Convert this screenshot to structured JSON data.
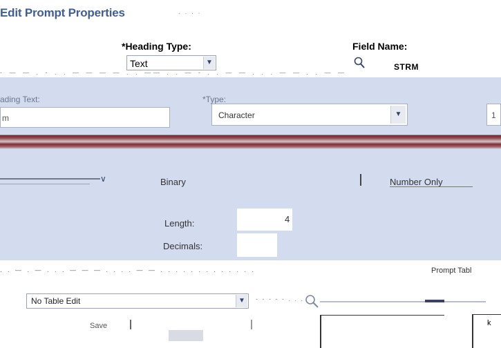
{
  "page": {
    "title": "Edit Prompt Properties"
  },
  "top_form": {
    "heading_type_label": "*Heading Type:",
    "heading_type_value": "Text",
    "field_name_label": "Field Name:",
    "field_name_value": "STRM"
  },
  "panel": {
    "heading_text_label": "ading Text:",
    "heading_text_value": "m",
    "type_label": "*Type:",
    "type_value": "Character",
    "right_value": "1"
  },
  "format_row": {
    "binary_label": "Binary",
    "number_only_label": "Number Only"
  },
  "size": {
    "length_label": "Length:",
    "length_value": "4",
    "decimals_label": "Decimals:",
    "decimals_value": ""
  },
  "edit_row": {
    "prompt_table_label": "Prompt Tabl",
    "edit_type_value": "No Table Edit"
  },
  "bottom": {
    "button_label": "Save",
    "ok_label": "k"
  },
  "colors": {
    "title": "#3f5e93",
    "panel_bg": "#d3dcee",
    "band": "#6d2a31"
  },
  "icons": [
    "chevron-down-icon",
    "search-icon",
    "lookup-icon"
  ]
}
